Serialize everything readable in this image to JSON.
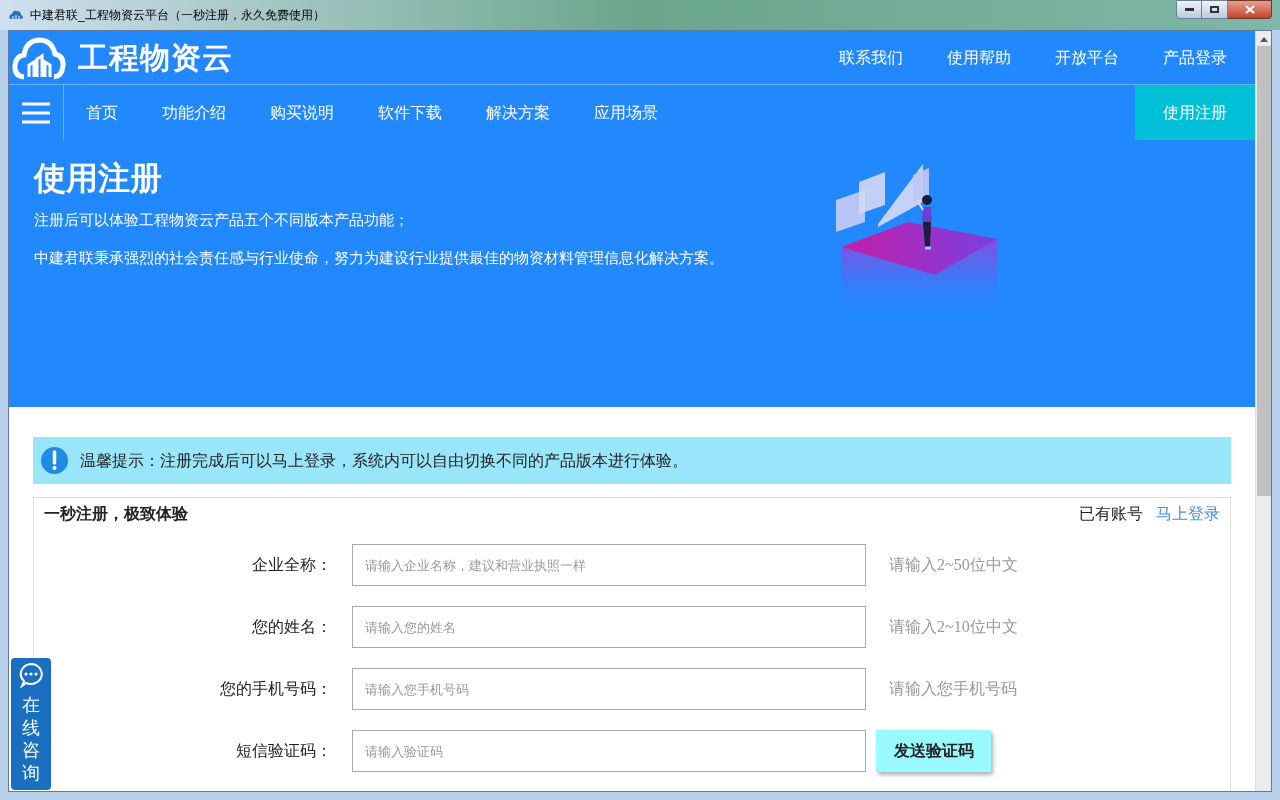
{
  "window": {
    "title": "中建君联_工程物资云平台（一秒注册，永久免费使用）"
  },
  "header": {
    "logo_text": "工程物资云",
    "links": [
      "联系我们",
      "使用帮助",
      "开放平台",
      "产品登录"
    ]
  },
  "nav": {
    "items": [
      {
        "label": "首页",
        "selected": false
      },
      {
        "label": "功能介绍",
        "selected": false
      },
      {
        "label": "购买说明",
        "selected": false
      },
      {
        "label": "软件下载",
        "selected": false
      },
      {
        "label": "解决方案",
        "selected": false
      },
      {
        "label": "应用场景",
        "selected": false
      }
    ],
    "register": {
      "label": "使用注册",
      "selected": true
    }
  },
  "hero": {
    "title": "使用注册",
    "lines": [
      "注册后可以体验工程物资云产品五个不同版本产品功能；",
      "中建君联秉承强烈的社会责任感与行业使命，努力为建设行业提供最佳的物资材料管理信息化解决方案。"
    ]
  },
  "notice": {
    "text": "温馨提示：注册完成后可以马上登录，系统内可以自由切换不同的产品版本进行体验。"
  },
  "form": {
    "title": "一秒注册，极致体验",
    "login_prompt": "已有账号",
    "login_link": "马上登录",
    "fields": [
      {
        "label": "企业全称：",
        "placeholder": "请输入企业名称，建议和营业执照一样",
        "kind": "hint",
        "extra": "请输入2~50位中文"
      },
      {
        "label": "您的姓名：",
        "placeholder": "请输入您的姓名",
        "kind": "hint",
        "extra": "请输入2~10位中文"
      },
      {
        "label": "您的手机号码：",
        "placeholder": "请输入您手机号码",
        "kind": "hint",
        "extra": "请输入您手机号码"
      },
      {
        "label": "短信验证码：",
        "placeholder": "请输入验证码",
        "kind": "button",
        "extra": "发送验证码"
      }
    ]
  },
  "chat_widget": {
    "label": "在线咨询"
  }
}
